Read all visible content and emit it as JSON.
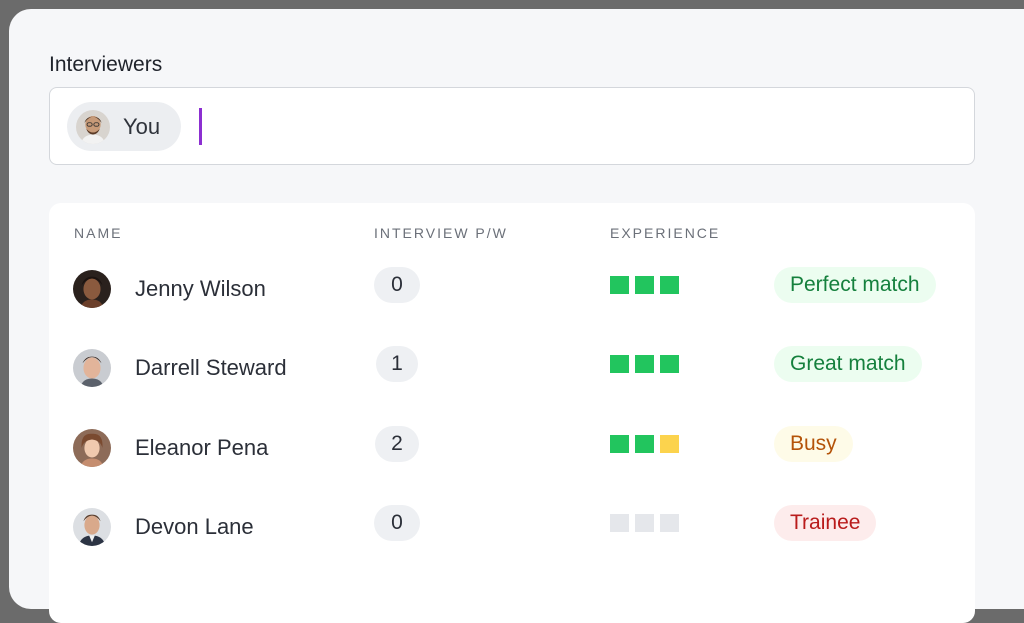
{
  "field": {
    "label": "Interviewers",
    "chip_label": "You"
  },
  "table": {
    "headers": {
      "name": "NAME",
      "interview": "INTERVIEW P/W",
      "experience": "EXPERIENCE"
    },
    "rows": [
      {
        "name": "Jenny Wilson",
        "count": "0",
        "experience": [
          "#22c55e",
          "#22c55e",
          "#22c55e"
        ],
        "status": "Perfect match",
        "status_color": "#15803d",
        "status_bg": "#ecfdf0"
      },
      {
        "name": "Darrell Steward",
        "count": "1",
        "experience": [
          "#22c55e",
          "#22c55e",
          "#22c55e"
        ],
        "status": "Great match",
        "status_color": "#15803d",
        "status_bg": "#ecfdf0"
      },
      {
        "name": "Eleanor Pena",
        "count": "2",
        "experience": [
          "#22c55e",
          "#22c55e",
          "#fcd34d"
        ],
        "status": "Busy",
        "status_color": "#b45309",
        "status_bg": "#fefbe8"
      },
      {
        "name": "Devon Lane",
        "count": "0",
        "experience": [
          "#e5e7eb",
          "#e5e7eb",
          "#e5e7eb"
        ],
        "status": "Trainee",
        "status_color": "#b91c1c",
        "status_bg": "#fdecec"
      }
    ]
  },
  "colors": {
    "caret": "#8c2fd1",
    "experience_full": "#22c55e",
    "experience_partial": "#fcd34d",
    "experience_empty": "#e5e7eb"
  }
}
